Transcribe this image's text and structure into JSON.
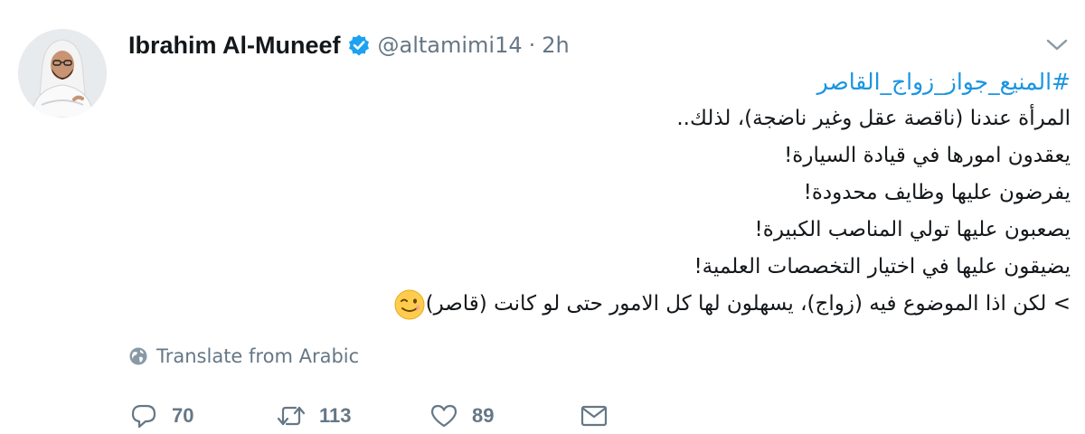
{
  "tweet": {
    "author": {
      "display_name": "Ibrahim Al-Muneef",
      "verified": true,
      "handle": "@altamimi14",
      "separator": "·",
      "time": "2h"
    },
    "menu_icon": "chevron-down-icon",
    "lines": [
      "#المنيع_جواز_زواج_القاصر",
      "المرأة عندنا (ناقصة عقل وغير ناضجة)، لذلك..",
      "يعقدون امورها في قيادة السيارة!",
      "يفرضون عليها وظايف محدودة!",
      "يصعبون عليها تولي المناصب الكبيرة!",
      "يضيقون عليها في اختيار التخصصات العلمية!",
      "> لكن اذا الموضوع فيه (زواج)، يسهلون لها كل الامور حتى لو كانت (قاصر)"
    ],
    "emoji": "winking-face-emoji",
    "translate": {
      "icon": "globe-icon",
      "label": "Translate from Arabic"
    },
    "actions": {
      "reply": {
        "icon": "reply-icon",
        "count": "70"
      },
      "retweet": {
        "icon": "retweet-icon",
        "count": "113"
      },
      "like": {
        "icon": "heart-icon",
        "count": "89"
      },
      "message": {
        "icon": "envelope-icon"
      }
    },
    "colors": {
      "hashtag": "#1b95e0",
      "verified": "#1da1f2",
      "secondary_text": "#657786",
      "primary_text": "#14171a"
    }
  }
}
